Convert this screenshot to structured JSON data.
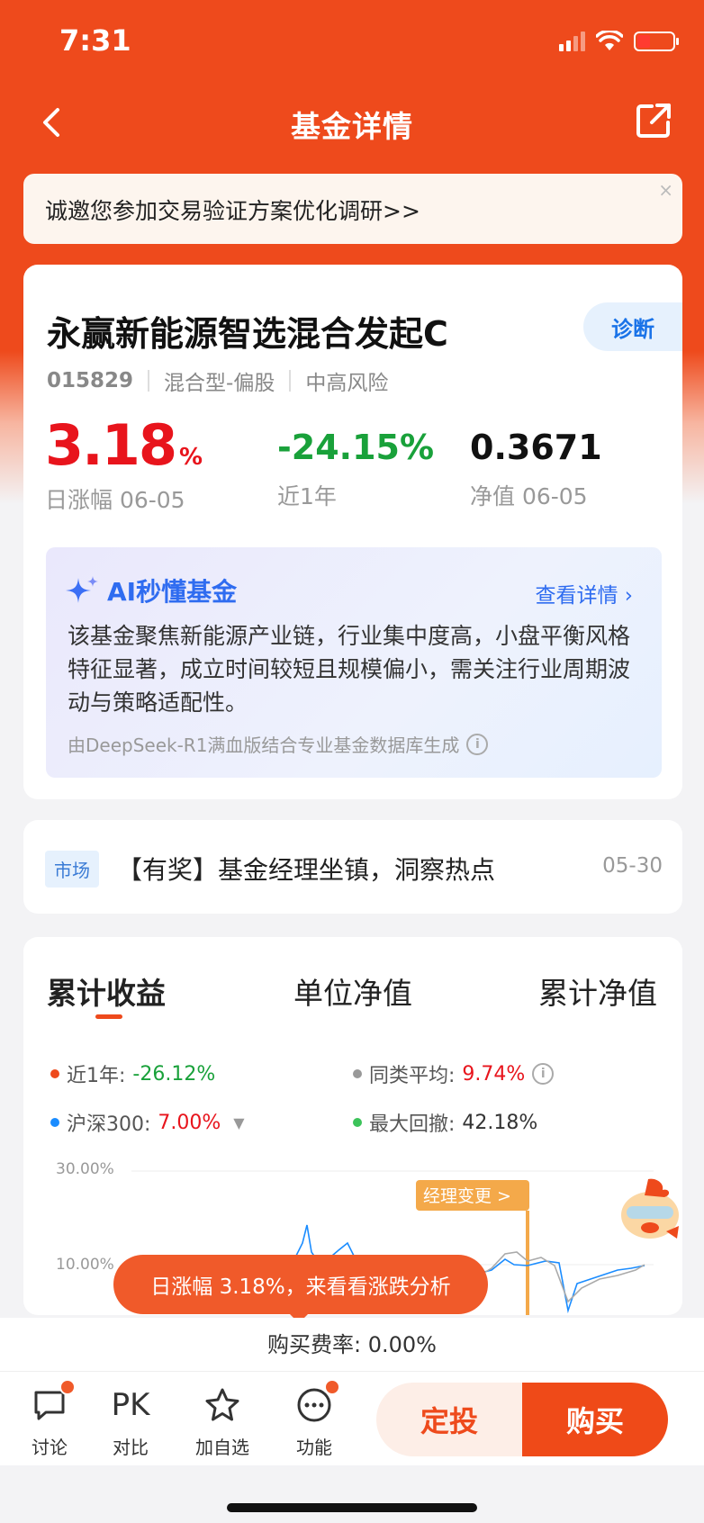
{
  "status": {
    "time": "7:31"
  },
  "nav": {
    "title": "基金详情"
  },
  "banner": {
    "text": "诚邀您参加交易验证方案优化调研>>",
    "close": "×"
  },
  "fund": {
    "name": "永赢新能源智选混合发起C",
    "diagnose_label": "诊断",
    "code": "015829",
    "type": "混合型-偏股",
    "risk": "中高风险",
    "daily_change_value": "3.18",
    "daily_change_unit": "%",
    "daily_change_label": "日涨幅 06-05",
    "year_change": "-24.15%",
    "year_label": "近1年",
    "nav_value": "0.3671",
    "nav_label": "净值 06-05"
  },
  "ai": {
    "title": "AI秒懂基金",
    "more": "查看详情",
    "body": "该基金聚焦新能源产业链，行业集中度高，小盘平衡风格特征显著，成立时间较短且规模偏小，需关注行业周期波动与策略适配性。",
    "footer": "由DeepSeek-R1满血版结合专业基金数据库生成"
  },
  "news": {
    "tag": "市场",
    "text": "【有奖】基金经理坐镇，洞察热点",
    "date": "05-30"
  },
  "chart": {
    "tabs": [
      "累计收益",
      "单位净值",
      "累计净值"
    ],
    "legend": {
      "fund_label": "近1年:",
      "fund_value": "-26.12%",
      "peer_label": "同类平均:",
      "peer_value": "9.74%",
      "index_label": "沪深300:",
      "index_value": "7.00%",
      "drawdown_label": "最大回撤:",
      "drawdown_value": "42.18%"
    },
    "y_labels": [
      "30.00%",
      "10.00%"
    ],
    "manager_change": "经理变更 >",
    "colors": {
      "fund": "#ee4a1c",
      "peer": "#999999",
      "index": "#1a8cff",
      "drawdown": "#3cc35a"
    }
  },
  "tooltip": {
    "text": "日涨幅 3.18%，来看看涨跌分析"
  },
  "fee": {
    "text": "购买费率: 0.00%"
  },
  "bottom": {
    "discuss": "讨论",
    "pk_icon": "PK",
    "compare": "对比",
    "watch": "加自选",
    "func": "功能",
    "dingtou": "定投",
    "buy": "购买"
  }
}
